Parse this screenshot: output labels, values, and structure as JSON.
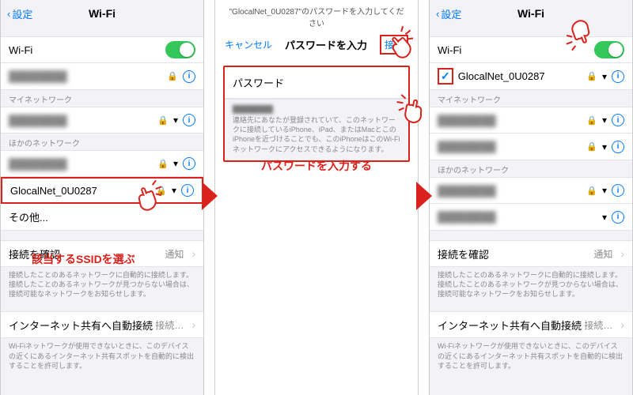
{
  "nav": {
    "back": "設定",
    "title": "Wi-Fi"
  },
  "wifi_label": "Wi-Fi",
  "sections": {
    "my_networks": "マイネットワーク",
    "other_networks": "ほかのネットワーク"
  },
  "target_ssid": "GlocalNet_0U0287",
  "other_item": "その他...",
  "ask_to_join": {
    "title": "接続を確認",
    "value": "通知",
    "desc": "接続したことのあるネットワークに自動的に接続します。接続したことのあるネットワークが見つからない場合は、接続可能なネットワークをお知らせします。"
  },
  "hotspot": {
    "title": "インターネット共有へ自動接続",
    "value": "接続…",
    "desc": "Wi-Fiネットワークが使用できないときに、このデバイスの近くにあるインターネット共有スポットを自動的に検出することを許可します。"
  },
  "modal": {
    "prompt_prefix": "\"",
    "prompt_suffix": "\"のパスワードを入力してください",
    "cancel": "キャンセル",
    "title": "パスワードを入力",
    "join": "接続",
    "password_label": "パスワード",
    "hint": "連絡先にあなたが登録されていて、このネットワークに接続しているiPhone、iPad、またはMacとこのiPhoneを近づけることでも、このiPhoneはこのWi-Fiネットワークにアクセスできるようになります。"
  },
  "captions": {
    "step1": "該当するSSIDを選ぶ",
    "step2": "パスワードを入力する"
  },
  "blur_placeholder": "████████"
}
